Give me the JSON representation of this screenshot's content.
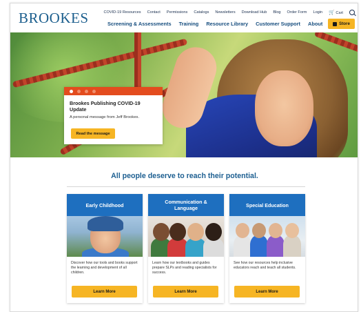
{
  "header": {
    "logo": "BROOKES",
    "utility_links": [
      "COVID-19 Resources",
      "Contact",
      "Permissions",
      "Catalogs",
      "Newsletters",
      "Download Hub",
      "Blog",
      "Order Form",
      "Login"
    ],
    "cart_label": "Cart",
    "main_nav": [
      "Screening & Assessments",
      "Training",
      "Resource Library",
      "Customer Support",
      "About"
    ],
    "store_label": "Store"
  },
  "hero": {
    "promo_title": "Brookes Publishing COVID-19 Update",
    "promo_subtitle": "A personal message from Jeff Brookes.",
    "promo_button": "Read the message",
    "slide_count": 4,
    "active_slide": 1
  },
  "tagline": "All people deserve to reach their potential.",
  "cards": [
    {
      "title": "Early Childhood",
      "text": "Discover how our tools and books support the learning and development of all children.",
      "button": "Learn More"
    },
    {
      "title": "Communication & Language",
      "text": "Learn how our textbooks and guides prepare SLPs and reading specialists for success.",
      "button": "Learn More"
    },
    {
      "title": "Special Education",
      "text": "See how our resources help inclusive educators reach and teach all students.",
      "button": "Learn More"
    }
  ],
  "colors": {
    "brand_blue": "#1b5e8d",
    "card_blue": "#1e6fbf",
    "accent_yellow": "#f6b524",
    "promo_orange": "#e34c1e"
  }
}
